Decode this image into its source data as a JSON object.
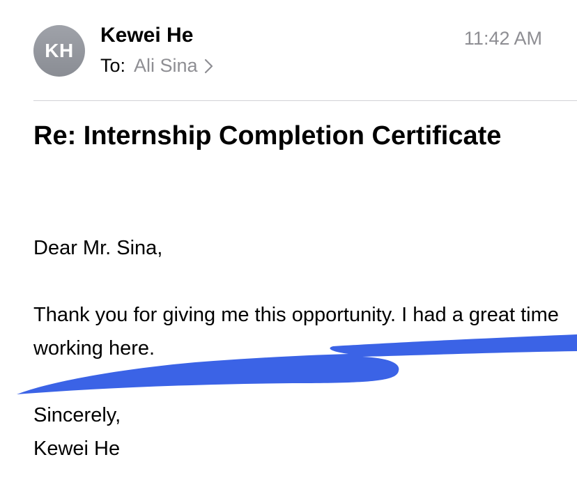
{
  "header": {
    "avatar_initials": "KH",
    "sender_name": "Kewei He",
    "to_label": "To:",
    "recipient": "Ali Sina",
    "timestamp": "11:42 AM"
  },
  "email": {
    "subject": "Re: Internship Completion Certificate",
    "greeting": "Dear Mr. Sina,",
    "body": "Thank you for giving me this opportunity. I had a great time working here.",
    "closing": "Sincerely,",
    "signature": "Kewei He"
  },
  "annotation": {
    "stroke_color": "#3b63e6",
    "icon": "highlight-scribble"
  }
}
